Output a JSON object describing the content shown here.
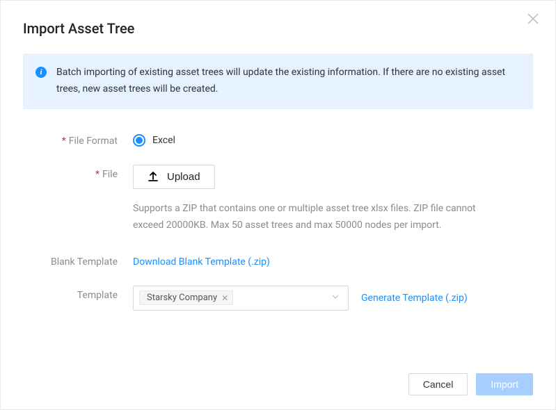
{
  "modal": {
    "title": "Import Asset Tree"
  },
  "alert": {
    "text": "Batch importing of existing asset trees will update the existing information. If there are no existing asset trees, new asset trees will be created."
  },
  "form": {
    "file_format": {
      "label": "File Format",
      "option": "Excel"
    },
    "file": {
      "label": "File",
      "upload_label": "Upload",
      "help": "Supports a ZIP that contains one or multiple asset tree xlsx files. ZIP file cannot exceed 20000KB. Max 50 asset trees and max 50000 nodes per import."
    },
    "blank_template": {
      "label": "Blank Template",
      "link": "Download Blank Template (.zip)"
    },
    "template": {
      "label": "Template",
      "selected": "Starsky Company",
      "generate_link": "Generate Template (.zip)"
    }
  },
  "footer": {
    "cancel": "Cancel",
    "import": "Import"
  }
}
